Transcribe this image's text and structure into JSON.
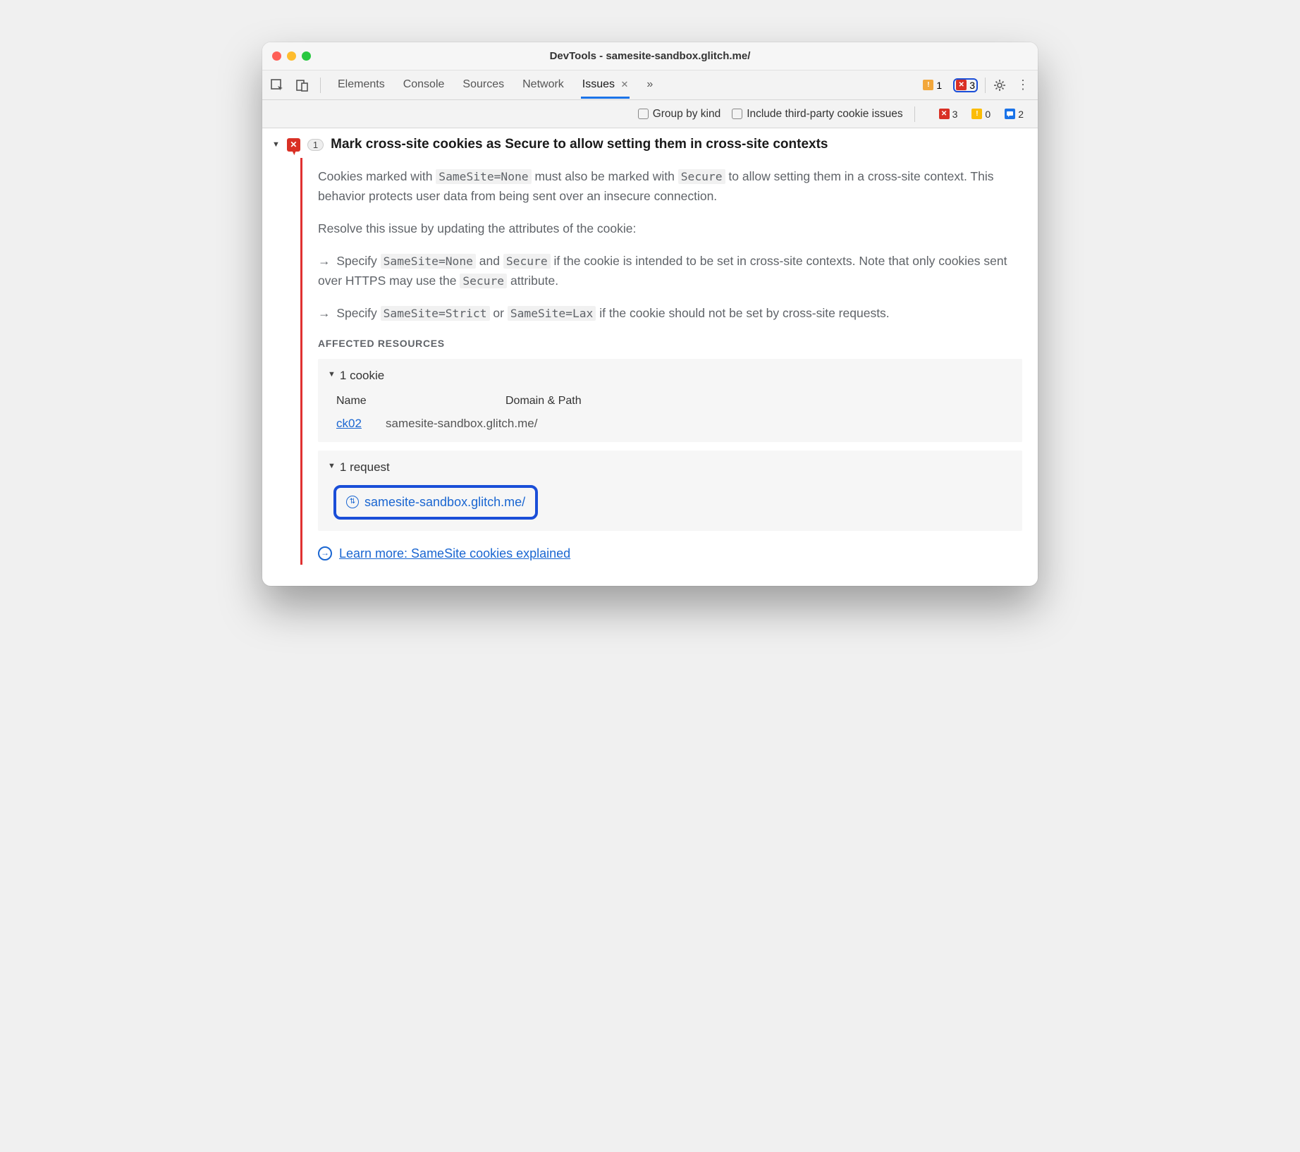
{
  "window": {
    "title": "DevTools - samesite-sandbox.glitch.me/"
  },
  "tabs": {
    "items": [
      "Elements",
      "Console",
      "Sources",
      "Network",
      "Issues"
    ],
    "active_index": 4
  },
  "toolbar_badges": {
    "warn_count": "1",
    "err_count_ring": "3"
  },
  "subbar": {
    "group_by_kind": "Group by kind",
    "third_party": "Include third-party cookie issues",
    "counts": {
      "err": "3",
      "info": "0",
      "msg": "2"
    }
  },
  "issue": {
    "count": "1",
    "title": "Mark cross-site cookies as Secure to allow setting them in cross-site contexts",
    "p1a": "Cookies marked with ",
    "p1code1": "SameSite=None",
    "p1b": " must also be marked with ",
    "p1code2": "Secure",
    "p1c": " to allow setting them in a cross-site context. This behavior protects user data from being sent over an insecure connection.",
    "p2": "Resolve this issue by updating the attributes of the cookie:",
    "b1a": "Specify ",
    "b1code1": "SameSite=None",
    "b1b": " and ",
    "b1code2": "Secure",
    "b1c": " if the cookie is intended to be set in cross-site contexts. Note that only cookies sent over HTTPS may use the ",
    "b1code3": "Secure",
    "b1d": " attribute.",
    "b2a": "Specify ",
    "b2code1": "SameSite=Strict",
    "b2b": " or ",
    "b2code2": "SameSite=Lax",
    "b2c": " if the cookie should not be set by cross-site requests.",
    "affected_label": "AFFECTED RESOURCES",
    "cookie_section": {
      "header": "1 cookie",
      "col_name": "Name",
      "col_domain": "Domain & Path",
      "row_name": "ck02",
      "row_domain": "samesite-sandbox.glitch.me/"
    },
    "request_section": {
      "header": "1 request",
      "url": "samesite-sandbox.glitch.me/"
    },
    "learn_more": "Learn more: SameSite cookies explained"
  }
}
